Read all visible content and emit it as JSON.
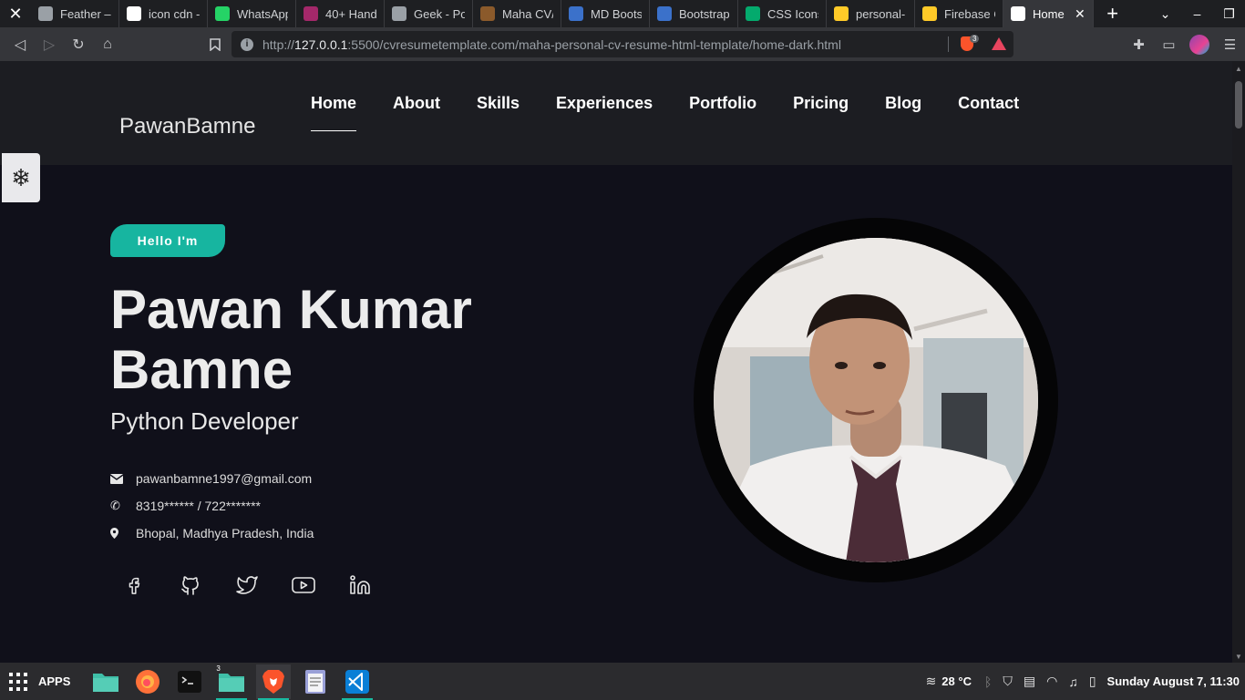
{
  "browser": {
    "tabs": [
      {
        "title": "Feather –",
        "icon": "feather-icon",
        "color": "#9aa0a6"
      },
      {
        "title": "icon cdn -",
        "icon": "google-icon",
        "color": "#ffffff"
      },
      {
        "title": "WhatsApp",
        "icon": "whatsapp-icon",
        "color": "#25d366"
      },
      {
        "title": "40+ Hand",
        "icon": "yoast-icon",
        "color": "#a4286a"
      },
      {
        "title": "Geek - Po",
        "icon": "globe-icon",
        "color": "#9aa0a6"
      },
      {
        "title": "Maha CV/",
        "icon": "book-icon",
        "color": "#8b5a2b"
      },
      {
        "title": "MD Boots",
        "icon": "mdb-icon",
        "color": "#3b71ca"
      },
      {
        "title": "Bootstrap",
        "icon": "mdb-icon",
        "color": "#3b71ca"
      },
      {
        "title": "CSS Icons",
        "icon": "w3-icon",
        "color": "#04aa6d"
      },
      {
        "title": "personal-",
        "icon": "firebase-icon",
        "color": "#ffca28"
      },
      {
        "title": "Firebase C",
        "icon": "firebase-icon",
        "color": "#ffca28"
      }
    ],
    "active_tab": {
      "title": "Home",
      "icon": "page-icon"
    },
    "url_scheme": "http://",
    "url_host": "127.0.0.1",
    "url_rest": ":5500/cvresumetemplate.com/maha-personal-cv-resume-html-template/home-dark.html",
    "shields_count": "3"
  },
  "site": {
    "logo": "PawanBamne",
    "nav": [
      "Home",
      "About",
      "Skills",
      "Experiences",
      "Portfolio",
      "Pricing",
      "Blog",
      "Contact"
    ],
    "hello": "Hello I'm",
    "name": "Pawan Kumar Bamne",
    "role": "Python Developer",
    "email": "pawanbamne1997@gmail.com",
    "phone": "8319****** / 722*******",
    "location": "Bhopal, Madhya Pradesh, India",
    "socials": [
      "facebook-icon",
      "github-icon",
      "twitter-icon",
      "youtube-icon",
      "linkedin-icon"
    ],
    "accent": "#17b5a0"
  },
  "taskbar": {
    "apps_label": "APPS",
    "files_badge": "3",
    "temperature": "28 °C",
    "clock": "Sunday August  7, 11:30"
  }
}
